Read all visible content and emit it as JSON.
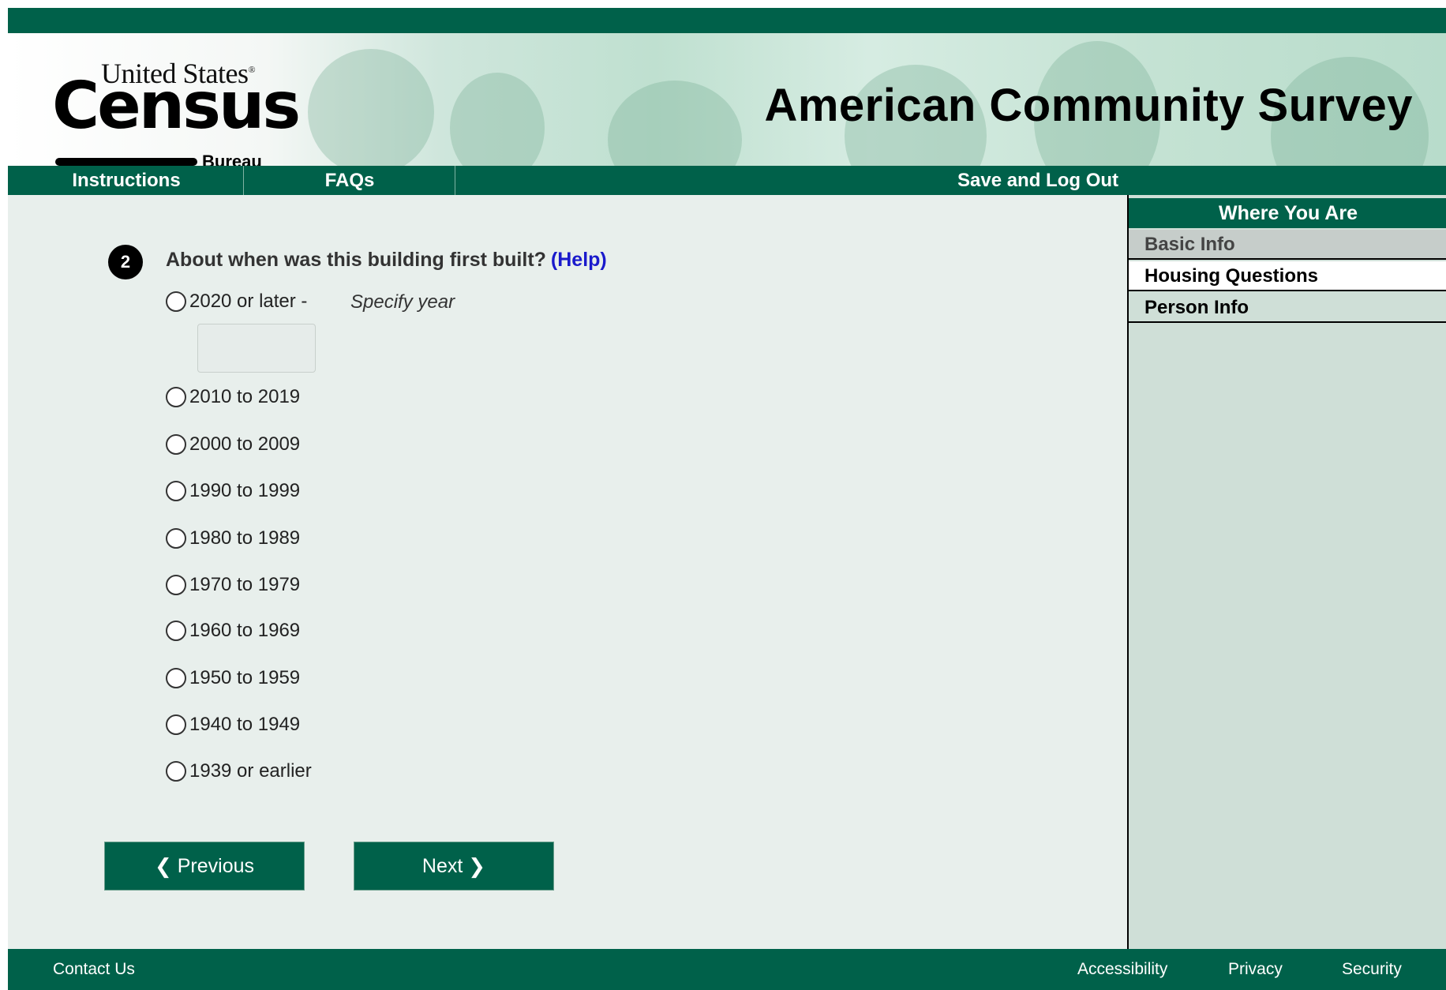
{
  "header": {
    "logo_united_states": "United States",
    "logo_census": "Census",
    "logo_bureau": "Bureau",
    "site_title": "American Community Survey"
  },
  "nav": {
    "instructions": "Instructions",
    "faqs": "FAQs",
    "save_logout": "Save and Log Out"
  },
  "question": {
    "number": "2",
    "text": "About when was this building first built?",
    "help": "(Help)",
    "specify_label": "Specify year",
    "year_value": "",
    "options": [
      "2020 or later -",
      "2010 to 2019",
      "2000 to 2009",
      "1990 to 1999",
      "1980 to 1989",
      "1970 to 1979",
      "1960 to 1969",
      "1950 to 1959",
      "1940 to 1949",
      "1939 or earlier"
    ],
    "selected": null
  },
  "buttons": {
    "previous": "Previous",
    "next": "Next"
  },
  "sidebar": {
    "title": "Where You Are",
    "items": [
      {
        "label": "Basic Info",
        "state": "completed"
      },
      {
        "label": "Housing Questions",
        "state": "current"
      },
      {
        "label": "Person Info",
        "state": "upcoming"
      }
    ]
  },
  "footer": {
    "contact": "Contact Us",
    "accessibility": "Accessibility",
    "privacy": "Privacy",
    "security": "Security"
  },
  "colors": {
    "brand_green": "#00614a",
    "help_link": "#1a1acc",
    "background": "#e8efec",
    "sidebar_bg": "#cfdfd7"
  }
}
